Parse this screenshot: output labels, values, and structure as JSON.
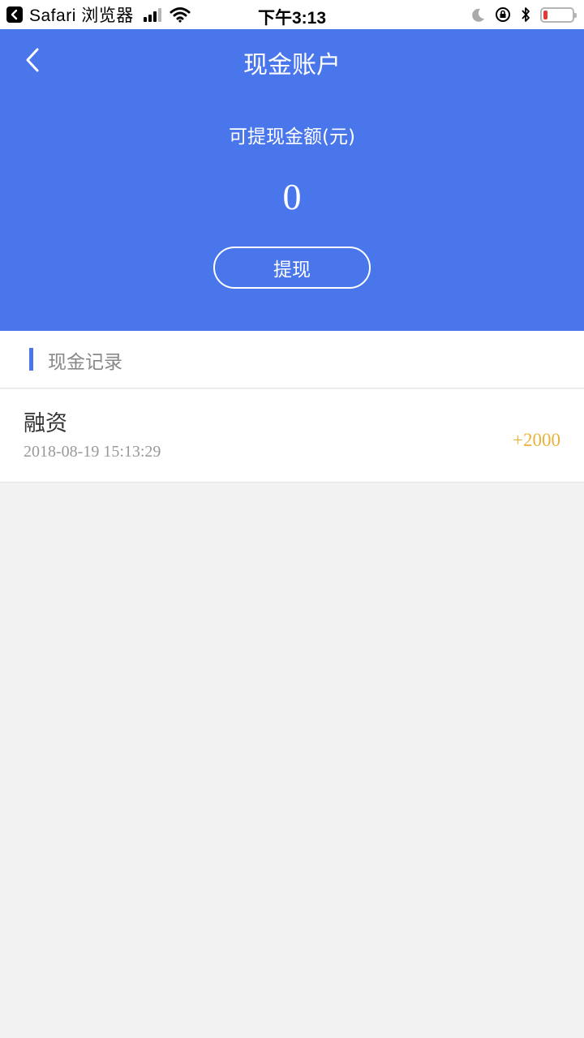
{
  "status_bar": {
    "back_app": "Safari 浏览器",
    "time": "下午3:13",
    "battery_level": 0.15
  },
  "header": {
    "title": "现金账户",
    "balance_label": "可提现金额(元)",
    "balance_value": "0",
    "withdraw_label": "提现",
    "accent_color": "#4a76ec"
  },
  "records_section": {
    "title": "现金记录"
  },
  "records": [
    {
      "title": "融资",
      "datetime": "2018-08-19 15:13:29",
      "amount": "+2000",
      "amount_color": "#e8b33a"
    }
  ]
}
